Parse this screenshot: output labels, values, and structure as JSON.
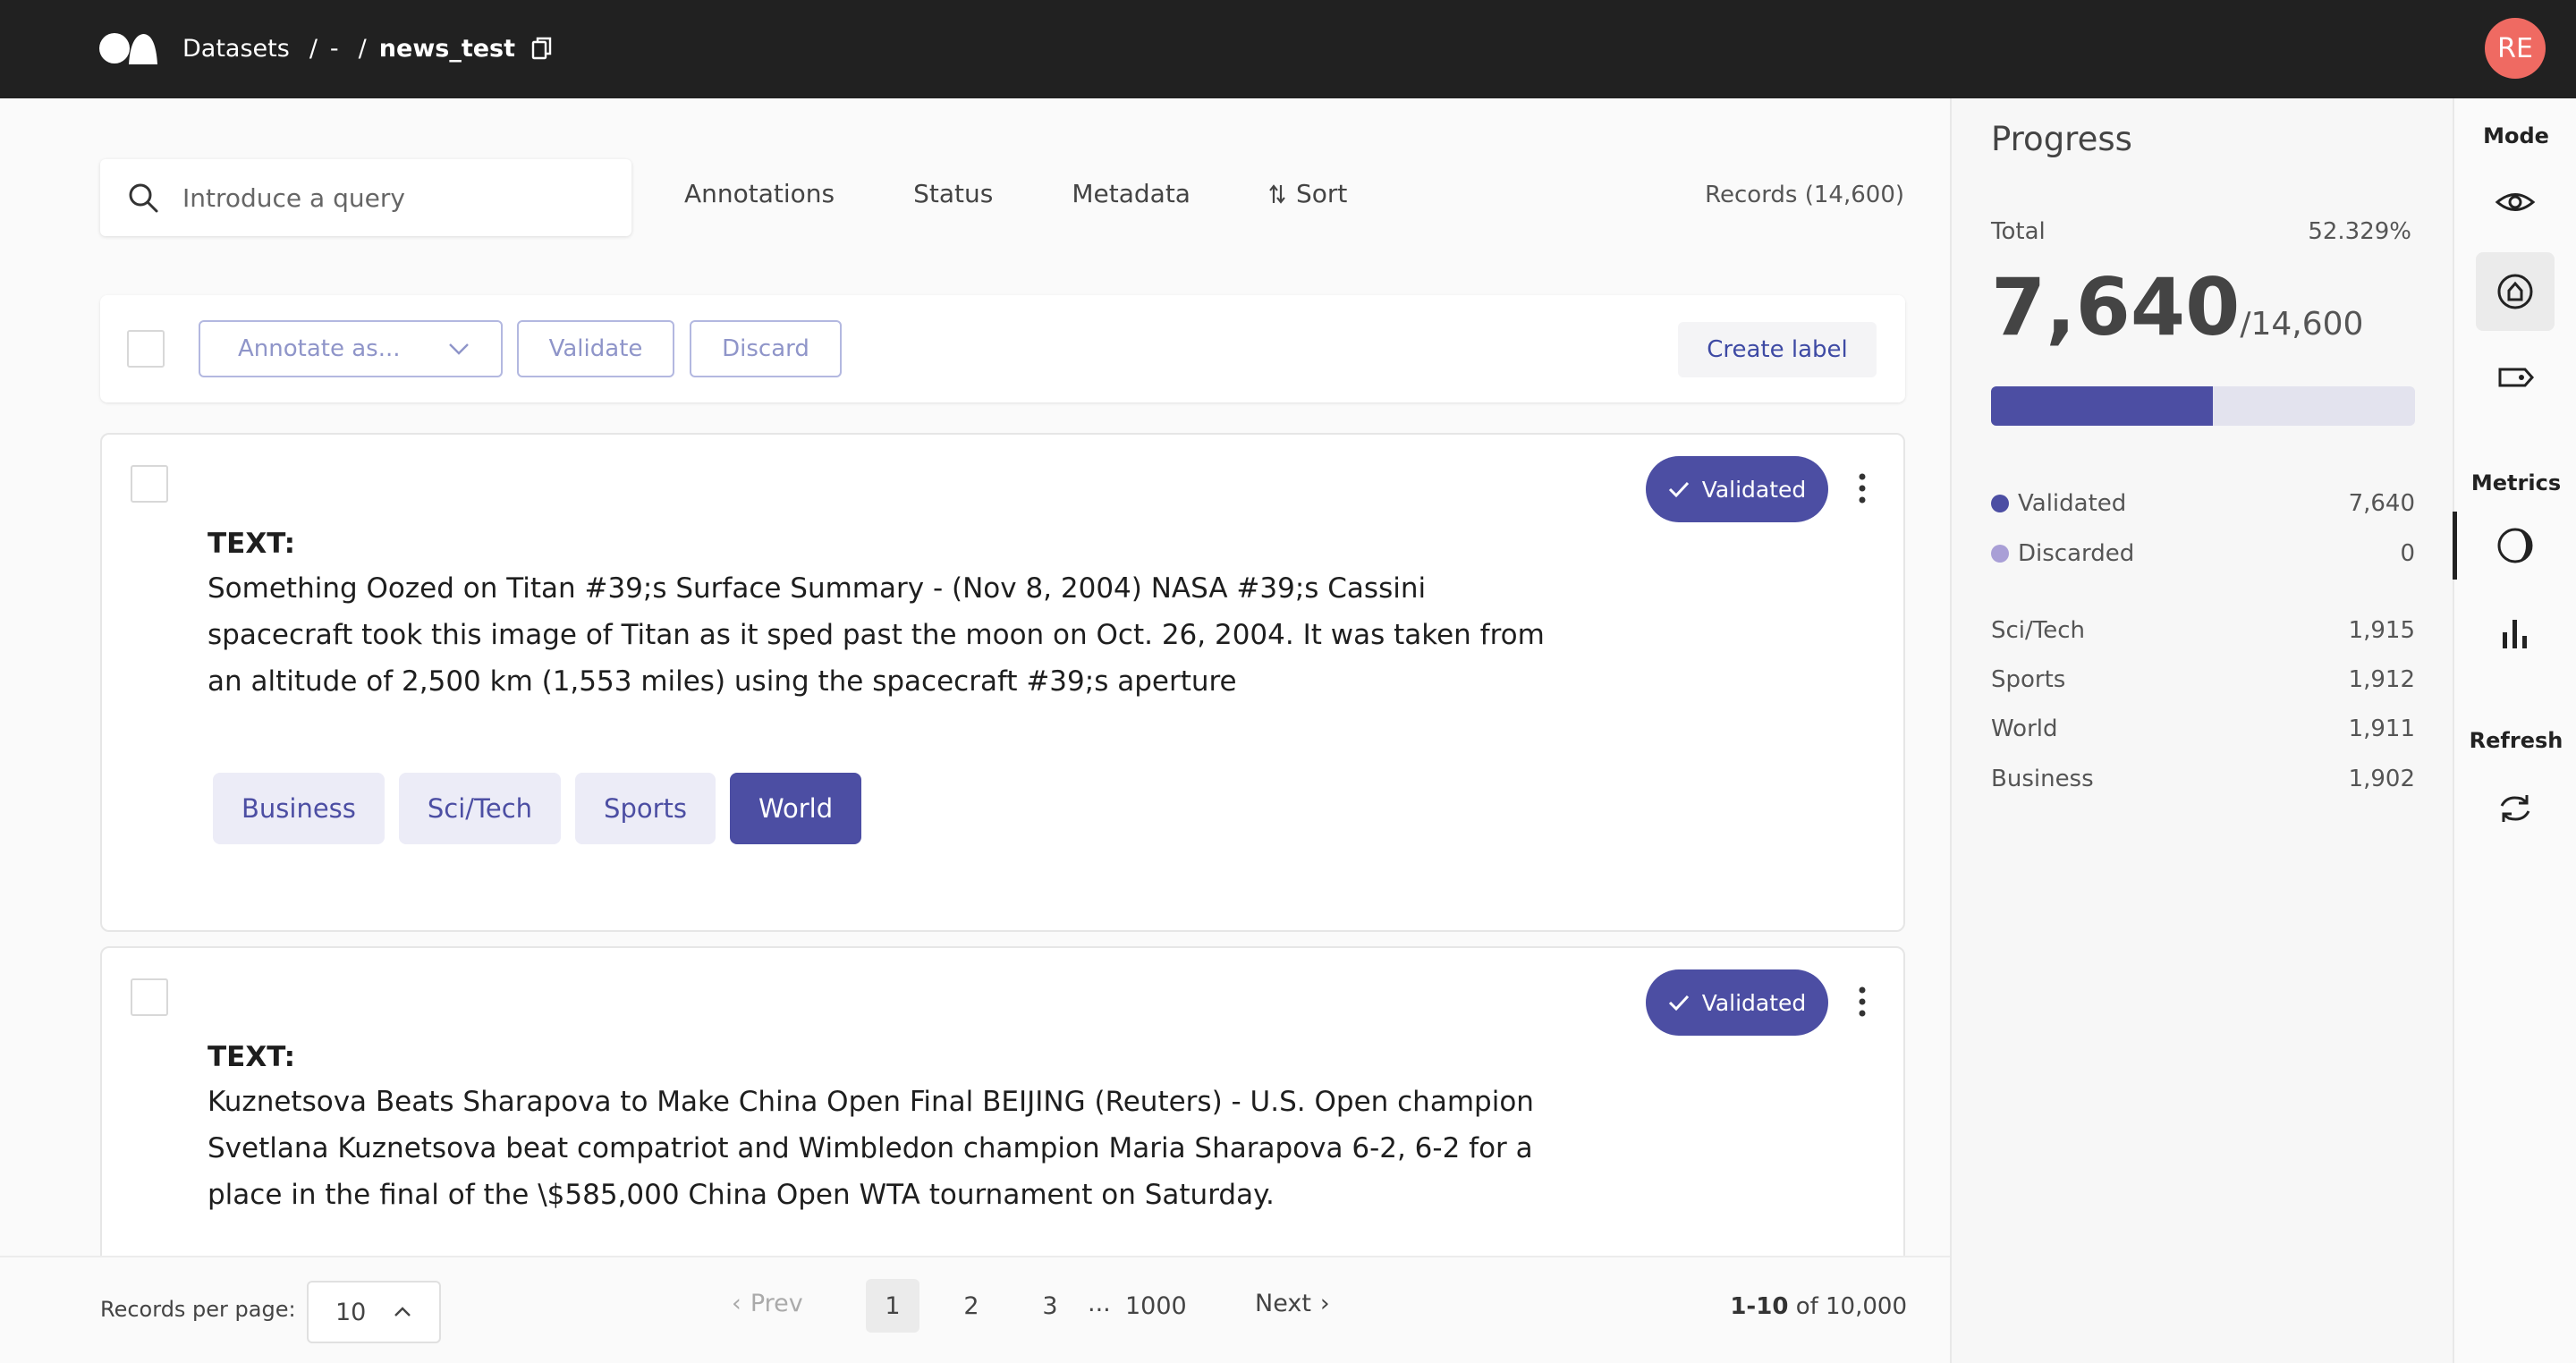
{
  "header": {
    "breadcrumbs": [
      "Datasets",
      "-",
      "news_test"
    ],
    "avatar_initials": "RE"
  },
  "toolbar": {
    "search_placeholder": "Introduce a query",
    "filters": [
      "Annotations",
      "Status",
      "Metadata"
    ],
    "sort_label": "Sort",
    "records_count": "Records (14,600)"
  },
  "bulk_actions": {
    "annotate_as": "Annotate as...",
    "validate": "Validate",
    "discard": "Discard",
    "create_label": "Create label"
  },
  "records": [
    {
      "status": "Validated",
      "field_name": "TEXT:",
      "text": "Something Oozed on Titan #39;s Surface Summary - (Nov 8, 2004) NASA #39;s Cassini spacecraft took this image of Titan as it sped past the moon on Oct. 26, 2004. It was taken from an altitude of 2,500 km (1,553 miles) using the spacecraft #39;s aperture",
      "labels": [
        "Business",
        "Sci/Tech",
        "Sports",
        "World"
      ],
      "selected_label": "World"
    },
    {
      "status": "Validated",
      "field_name": "TEXT:",
      "text": "Kuznetsova Beats Sharapova to Make China Open Final BEIJING (Reuters) - U.S. Open champion Svetlana Kuznetsova beat compatriot and Wimbledon champion Maria Sharapova 6-2, 6-2 for a place in the final of the \\$585,000 China Open WTA tournament on Saturday."
    }
  ],
  "pagination": {
    "per_page_label": "Records per page:",
    "per_page_value": "10",
    "prev": "Prev",
    "next": "Next",
    "pages": [
      "1",
      "2",
      "3",
      "1000"
    ],
    "ellipsis": "...",
    "range_bold": "1-10",
    "range_rest": "of 10,000"
  },
  "progress": {
    "title": "Progress",
    "total_label": "Total",
    "total_percent": "52.329%",
    "annotated": "7,640",
    "total": "/14,600",
    "fraction": 0.52329,
    "validated_label": "Validated",
    "validated_value": "7,640",
    "validated_color": "#4c4ea3",
    "discarded_label": "Discarded",
    "discarded_value": "0",
    "discarded_color": "#a99fd6",
    "labels": [
      {
        "name": "Sci/Tech",
        "value": "1,915"
      },
      {
        "name": "Sports",
        "value": "1,912"
      },
      {
        "name": "World",
        "value": "1,911"
      },
      {
        "name": "Business",
        "value": "1,902"
      }
    ]
  },
  "rail": {
    "mode_label": "Mode",
    "metrics_label": "Metrics",
    "refresh_label": "Refresh",
    "icons": [
      "eye-icon",
      "annotate-icon",
      "tag-icon",
      "progress-icon",
      "bar-chart-icon",
      "refresh-icon"
    ]
  }
}
